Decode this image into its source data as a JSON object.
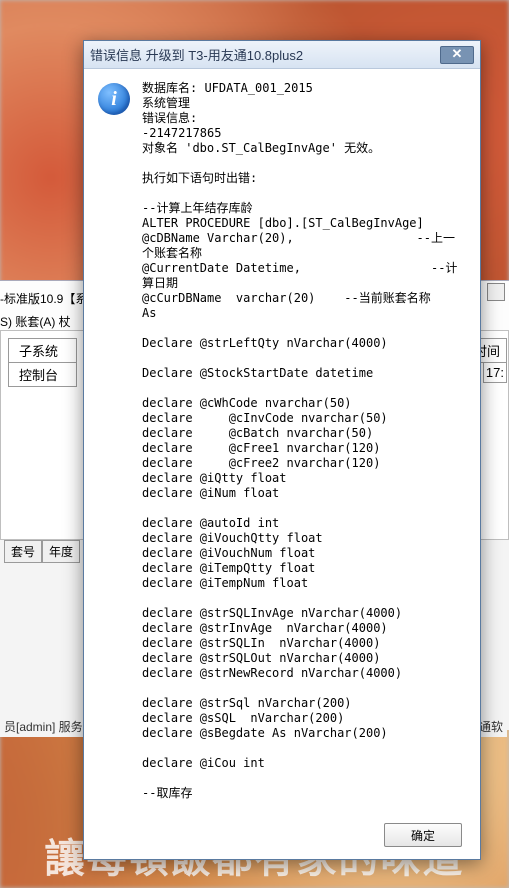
{
  "background": {
    "main_window_title_fragment": "-标准版10.9【系",
    "menu_fragment": "S) 账套(A) 杖",
    "grid_header1": "子系统",
    "grid_header2": "控制台",
    "grid_header_time_label": "时间",
    "grid_time_value": "17:",
    "button_acct_no": "套号",
    "button_year": "年度",
    "status_left": "员[admin]     服务",
    "status_right": "通软",
    "banner": "讓每頓飯都有家的味道"
  },
  "dialog": {
    "title": "错误信息  升级到 T3-用友通10.8plus2",
    "icon_glyph": "i",
    "close_glyph": "✕",
    "ok_label": "确定",
    "message": "数据库名: UFDATA_001_2015\n系统管理\n错误信息:\n-2147217865\n对象名 'dbo.ST_CalBegInvAge' 无效。\n\n执行如下语句时出错:\n\n--计算上年结存库龄\nALTER PROCEDURE [dbo].[ST_CalBegInvAge]\n@cDBName Varchar(20),                 --上一个账套名称\n@CurrentDate Datetime,                  --计算日期\n@cCurDBName  varchar(20)    --当前账套名称\nAs\n\nDeclare @strLeftQty nVarchar(4000)\n\nDeclare @StockStartDate datetime\n\ndeclare @cWhCode nvarchar(50)\ndeclare     @cInvCode nvarchar(50)\ndeclare     @cBatch nvarchar(50)\ndeclare     @cFree1 nvarchar(120)\ndeclare     @cFree2 nvarchar(120)\ndeclare @iQtty float\ndeclare @iNum float\n\ndeclare @autoId int\ndeclare @iVouchQtty float\ndeclare @iVouchNum float\ndeclare @iTempQtty float\ndeclare @iTempNum float\n\ndeclare @strSQLInvAge nVarchar(4000)\ndeclare @strInvAge  nVarchar(4000)\ndeclare @strSQLIn  nVarchar(4000)\ndeclare @strSQLOut nVarchar(4000)\ndeclare @strNewRecord nVarchar(4000)\n\ndeclare @strSql nVarchar(200)\ndeclare @sSQL  nVarchar(200)\ndeclare @sBegdate As nVarchar(200)\n\ndeclare @iCou int\n\n--取库存"
  }
}
